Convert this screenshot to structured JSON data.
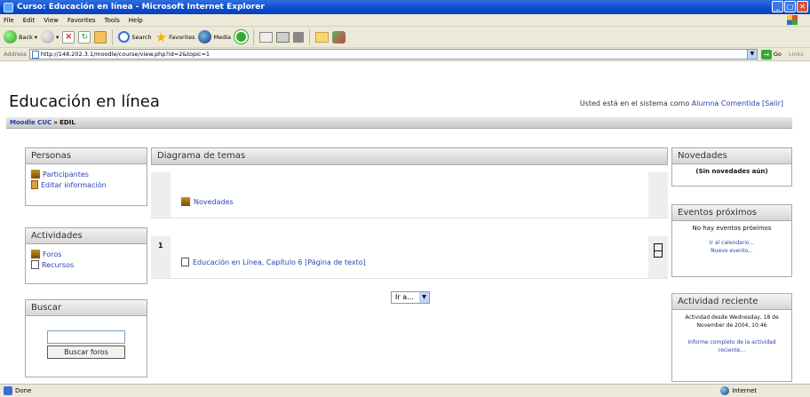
{
  "window": {
    "title": "Curso: Educación en línea - Microsoft Internet Explorer",
    "buttons": [
      "_",
      "□",
      "✕"
    ]
  },
  "menu": [
    "File",
    "Edit",
    "View",
    "Favorites",
    "Tools",
    "Help"
  ],
  "toolbar": {
    "back_label": "Back",
    "search_label": "Search",
    "favorites_label": "Favorites",
    "media_label": "Media"
  },
  "address": {
    "label": "Address",
    "url": "http://148.202.3.1/moodle/course/view.php?id=2&topic=1",
    "go_label": "Go",
    "links_label": "Links"
  },
  "page": {
    "title": "Educación en línea",
    "login_prefix": "Usted está en el sistema como",
    "user_name": "Alumna Comentida",
    "logout_label": "[Salir]",
    "breadcrumb": [
      "Moodle CUC",
      "EDIL"
    ],
    "breadcrumb_sep": "»"
  },
  "left_blocks": {
    "people": {
      "header": "Personas",
      "links": [
        "Participantes",
        "Editar información"
      ]
    },
    "activities": {
      "header": "Actividades",
      "links": [
        "Foros",
        "Recursos"
      ]
    },
    "search": {
      "header": "Buscar",
      "button_label": "Buscar foros",
      "input_value": ""
    }
  },
  "center": {
    "header": "Diagrama de temas",
    "section0_link": "Novedades",
    "section1_number": "1",
    "section1_link": "Educación en Línea, Capítulo 6 [Página de texto]",
    "jump_label": "Ir a..."
  },
  "right_blocks": {
    "news": {
      "header": "Novedades",
      "text": "(Sin novedades aún)"
    },
    "events": {
      "header": "Eventos próximos",
      "text": "No hay eventos próximos",
      "link_calendar": "Ir al calendario...",
      "link_new": "Nuevo evento..."
    },
    "recent": {
      "header": "Actividad reciente",
      "text": "Actividad desde Wednesday, 18 de November de 2004, 10:46",
      "link": "Informe completo de la actividad reciente..."
    }
  },
  "status": {
    "left": "Done",
    "zone": "Internet"
  },
  "colors": {
    "titlebar": "#0a4bd0",
    "link": "#2a43b4",
    "chrome": "#ece9d8"
  }
}
